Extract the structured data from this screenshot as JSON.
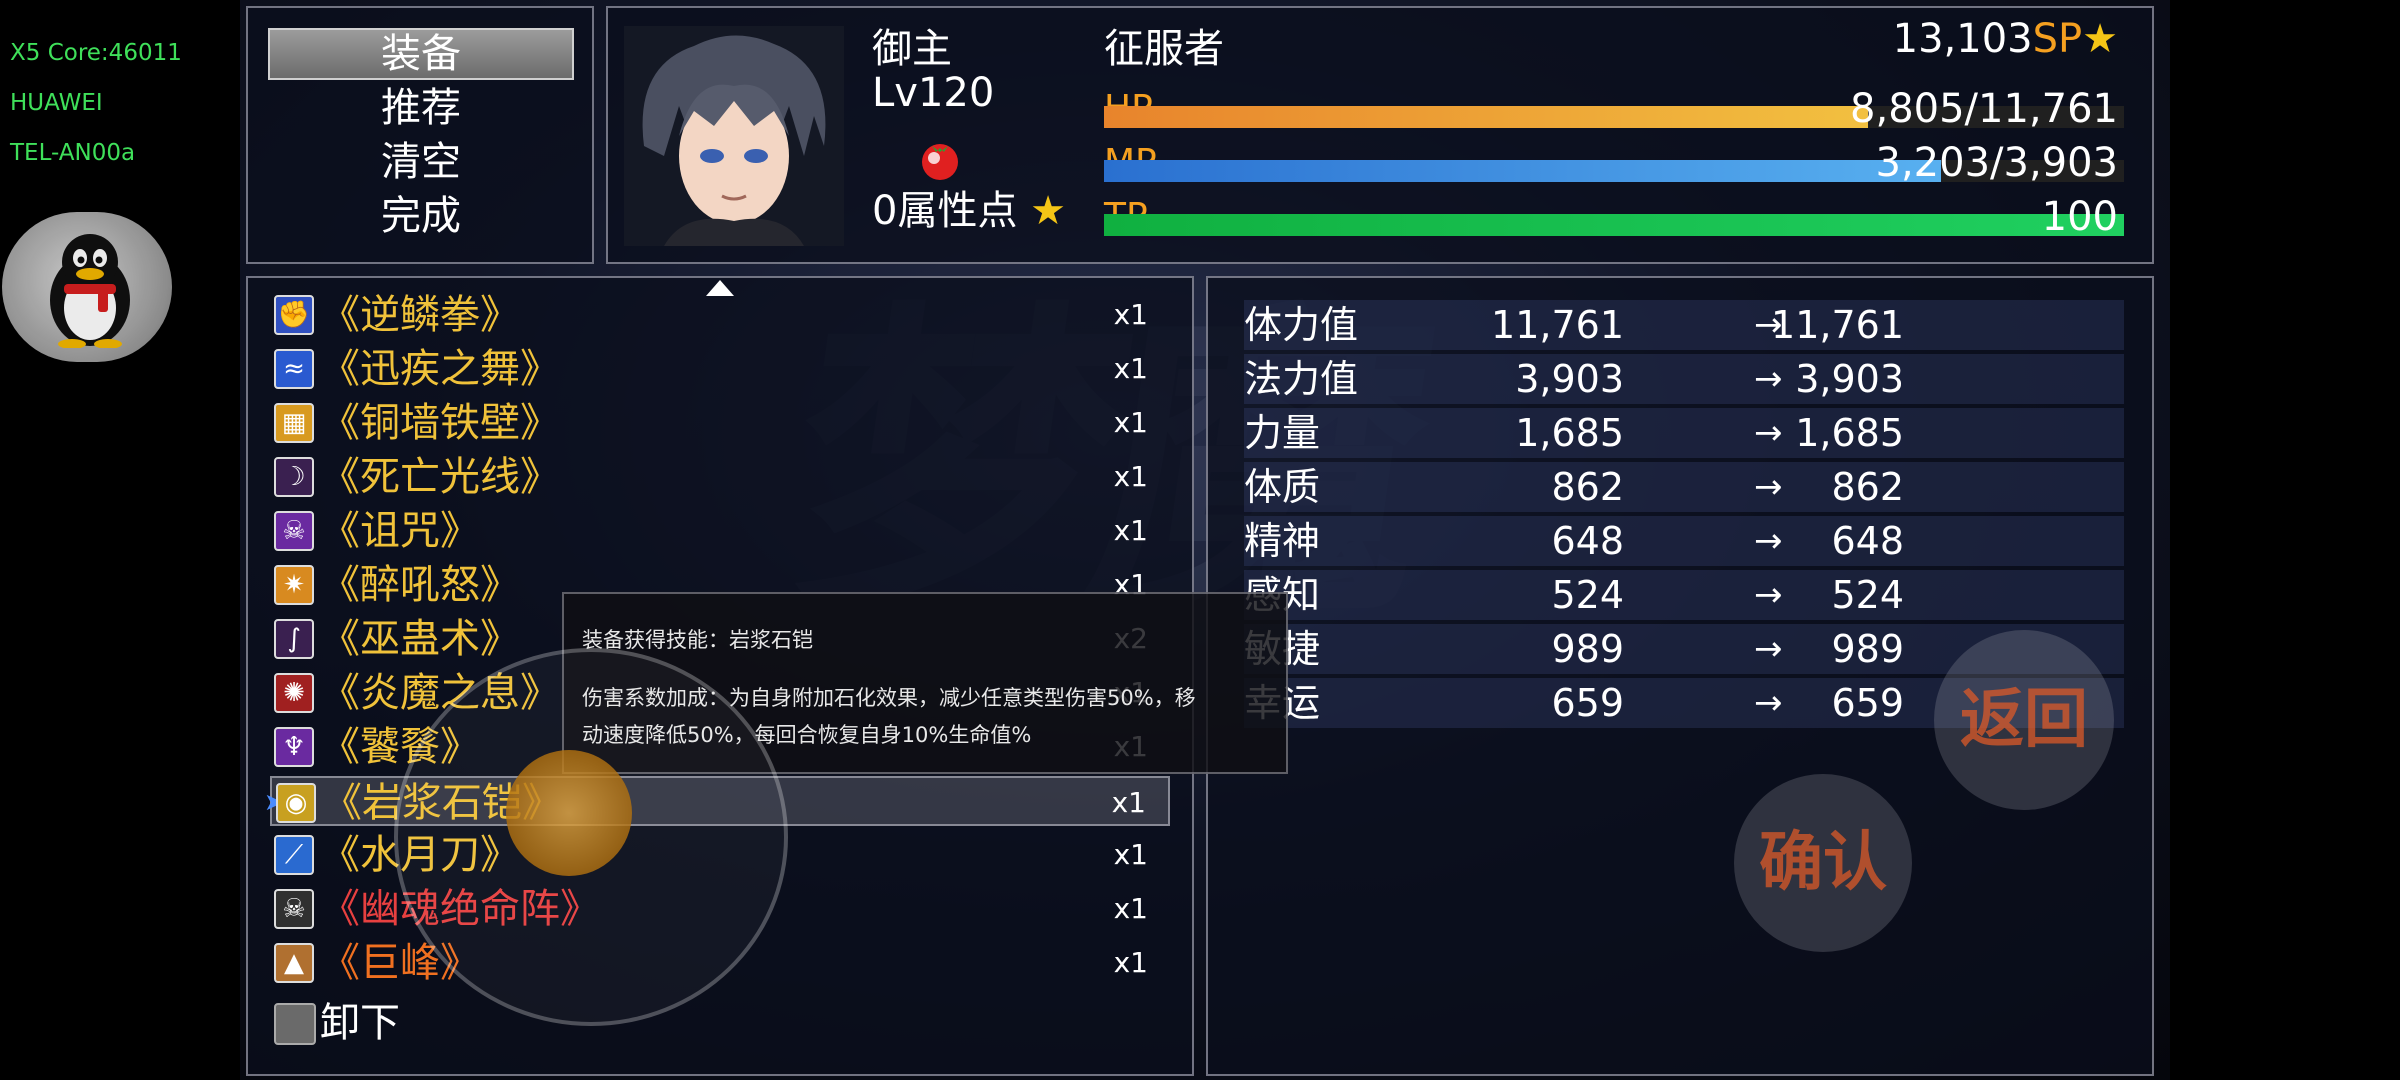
{
  "device_overlay": {
    "core": "X5 Core:46011",
    "brand": "HUAWEI",
    "model": "TEL-AN00a"
  },
  "commands": [
    {
      "label": "装备",
      "selected": true
    },
    {
      "label": "推荐",
      "selected": false
    },
    {
      "label": "清空",
      "selected": false
    },
    {
      "label": "完成",
      "selected": false
    }
  ],
  "actor": {
    "name": "御主",
    "level": "Lv120",
    "class": "征服者",
    "attribute_points": "0属性点",
    "sp_value": "13,103",
    "sp_unit": "SP",
    "hp": {
      "label": "HP",
      "text": "8,805/11,761",
      "ratio": 0.7487
    },
    "mp": {
      "label": "MP",
      "text": "3,203/3,903",
      "ratio": 0.8206
    },
    "tp": {
      "label": "TP",
      "text": "100",
      "ratio": 1.0
    }
  },
  "skills": [
    {
      "name": "《逆鳞拳》",
      "count": "x1",
      "color": "#f0c23a",
      "icon_bg": "#3050c0",
      "icon": "fist-icon"
    },
    {
      "name": "《迅疾之舞》",
      "count": "x1",
      "color": "#f0c23a",
      "icon_bg": "#2a5ad0",
      "icon": "dance-icon"
    },
    {
      "name": "《铜墙铁壁》",
      "count": "x1",
      "color": "#f0c23a",
      "icon_bg": "#d89a20",
      "icon": "shield-wall-icon"
    },
    {
      "name": "《死亡光线》",
      "count": "x1",
      "color": "#f0c23a",
      "icon_bg": "#3a2050",
      "icon": "death-ray-icon"
    },
    {
      "name": "《诅咒》",
      "count": "x1",
      "color": "#f0c23a",
      "icon_bg": "#6a2aa0",
      "icon": "skull-curse-icon"
    },
    {
      "name": "《醉吼怒》",
      "count": "x1",
      "color": "#f0c23a",
      "icon_bg": "#d88a20",
      "icon": "roar-icon"
    },
    {
      "name": "《巫蛊术》",
      "count": "x2",
      "color": "#f0c23a",
      "icon_bg": "#3a2050",
      "icon": "witchcraft-icon"
    },
    {
      "name": "《炎魔之息》",
      "count": "x1",
      "color": "#f0c23a",
      "icon_bg": "#a02020",
      "icon": "flame-breath-icon"
    },
    {
      "name": "《饕餮》",
      "count": "x1",
      "color": "#f0c23a",
      "icon_bg": "#6a2aa0",
      "icon": "beast-icon"
    },
    {
      "name": "《岩浆石铠》",
      "count": "x1",
      "color": "#f0c23a",
      "icon_bg": "#c8a020",
      "icon": "armor-icon",
      "selected": true
    },
    {
      "name": "《水月刀》",
      "count": "x1",
      "color": "#f0c23a",
      "icon_bg": "#2a6ad0",
      "icon": "blade-icon"
    },
    {
      "name": "《幽魂绝命阵》",
      "count": "x1",
      "color": "#e84040",
      "icon_bg": "#303030",
      "icon": "ghost-skull-icon"
    },
    {
      "name": "《巨峰》",
      "count": "x1",
      "color": "#f07020",
      "icon_bg": "#b07030",
      "icon": "mountain-icon"
    }
  ],
  "unequip_label": "卸下",
  "params": [
    {
      "name": "体力值",
      "current": "11,761",
      "new": "11,761"
    },
    {
      "name": "法力值",
      "current": "3,903",
      "new": "3,903"
    },
    {
      "name": "力量",
      "current": "1,685",
      "new": "1,685"
    },
    {
      "name": "体质",
      "current": "862",
      "new": "862"
    },
    {
      "name": "精神",
      "current": "648",
      "new": "648"
    },
    {
      "name": "感知",
      "current": "524",
      "new": "524"
    },
    {
      "name": "敏捷",
      "current": "989",
      "new": "989"
    },
    {
      "name": "幸运",
      "current": "659",
      "new": "659"
    }
  ],
  "arrow_glyph": "→",
  "tooltip": {
    "title": "装备获得技能：岩浆石铠",
    "desc_line1": "伤害系数加成：为自身附加石化效果，减少任意类型伤害50%，移",
    "desc_line2": "动速度降低50%，每回合恢复自身10%生命值%"
  },
  "buttons": {
    "back": "返回",
    "confirm": "确认"
  },
  "colors": {
    "hp_gradient": [
      "#e8842c",
      "#f2c040"
    ],
    "mp_gradient": [
      "#2a70d0",
      "#58b0f0"
    ],
    "tp_gradient": [
      "#10b040",
      "#20d060"
    ],
    "sp_unit": "#f5a020",
    "hp_mp_label": "#f5a020"
  }
}
